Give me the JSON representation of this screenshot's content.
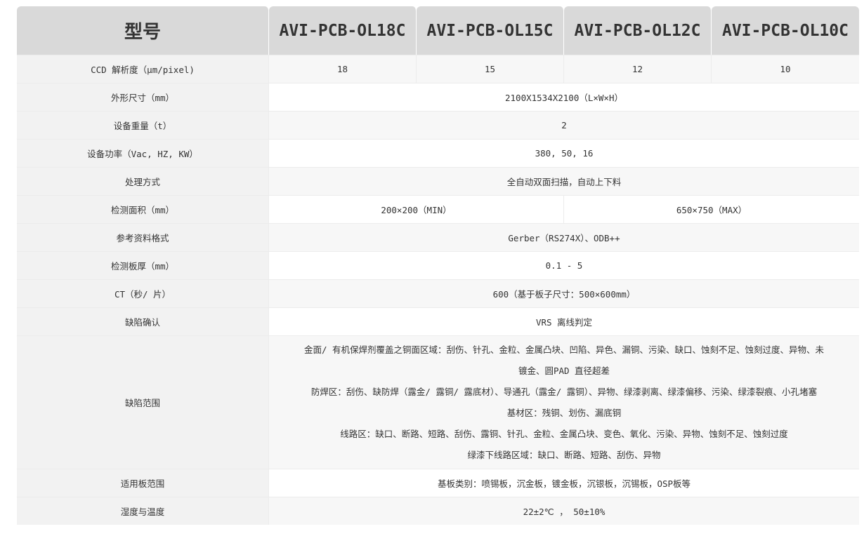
{
  "header": {
    "model_label": "型号",
    "models": [
      "AVI-PCB-OL18C",
      "AVI-PCB-OL15C",
      "AVI-PCB-OL12C",
      "AVI-PCB-OL10C"
    ]
  },
  "rows": {
    "ccd": {
      "label": "CCD 解析度（μm/pixel)",
      "values": [
        "18",
        "15",
        "12",
        "10"
      ]
    },
    "dimensions": {
      "label": "外形尺寸（mm）",
      "value": "2100X1534X2100（L×W×H）"
    },
    "weight": {
      "label": "设备重量（t）",
      "value": "2"
    },
    "power": {
      "label": "设备功率（Vac, HZ, KW）",
      "value": "380, 50, 16"
    },
    "processing": {
      "label": "处理方式",
      "value": "全自动双面扫描，自动上下料"
    },
    "area": {
      "label": "检测面积（mm）",
      "min": "200×200（MIN）",
      "max": "650×750（MAX）"
    },
    "reference": {
      "label": "参考资料格式",
      "value": "Gerber（RS274X）、ODB++"
    },
    "thickness": {
      "label": "检测板厚（mm）",
      "value": "0.1 - 5"
    },
    "ct": {
      "label": "CT（秒/ 片）",
      "value": "600（基于板子尺寸：500×600mm）"
    },
    "confirm": {
      "label": "缺陷确认",
      "value": "VRS 离线判定"
    },
    "defects": {
      "label": "缺陷范围",
      "lines": [
        "金面/ 有机保焊剂覆盖之铜面区域：刮伤、针孔、金粒、金属凸块、凹陷、异色、漏铜、污染、缺口、蚀刻不足、蚀刻过度、异物、未",
        "镀金、圆PAD 直径超差",
        "防焊区：刮伤、缺防焊（露金/ 露铜/ 露底材）、导通孔（露金/ 露铜）、异物、绿漆剥离、绿漆偏移、污染、绿漆裂痕、小孔堵塞",
        "基材区：残铜、划伤、漏底铜",
        "线路区：缺口、断路、短路、刮伤、露铜、针孔、金粒、金属凸块、变色、氧化、污染、异物、蚀刻不足、蚀刻过度",
        "绿漆下线路区域：缺口、断路、短路、刮伤、异物"
      ]
    },
    "boards": {
      "label": "适用板范围",
      "value": "基板类别：喷锡板，沉金板，镀金板，沉银板，沉锡板，OSP板等"
    },
    "env": {
      "label": "湿度与温度",
      "value": "22±2℃ ， 50±10%"
    }
  }
}
